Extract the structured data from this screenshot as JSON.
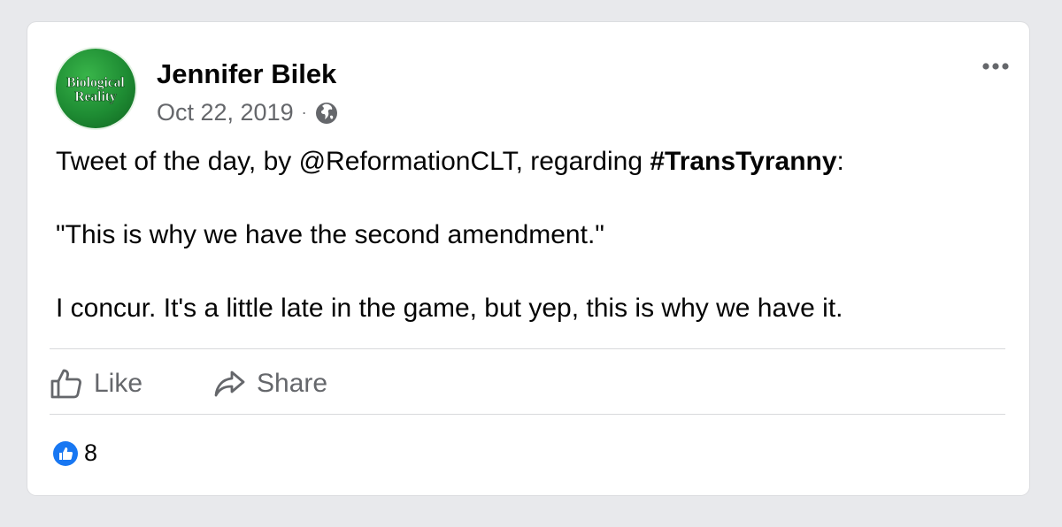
{
  "post": {
    "avatar": {
      "line1": "Biological",
      "line2": "Reality",
      "color": "#1e8c33"
    },
    "author": "Jennifer Bilek",
    "date": "Oct 22, 2019",
    "separator": "·",
    "audience_icon": "globe-icon",
    "more_icon": "more-options-icon",
    "body": {
      "p1_prefix": "Tweet of the day, by @ReformationCLT, regarding ",
      "p1_hashtag": "#TransTyranny",
      "p1_suffix": ":",
      "p2": "\"This is why we have the second amendment.\"",
      "p3": "I concur.  It's a little late in the game, but yep, this is why we have it."
    },
    "actions": {
      "like_label": "Like",
      "like_icon": "thumbs-up-outline-icon",
      "share_label": "Share",
      "share_icon": "share-arrow-icon"
    },
    "reactions": {
      "icon": "like-reaction-icon",
      "count": "8",
      "color": "#1877f2"
    }
  }
}
